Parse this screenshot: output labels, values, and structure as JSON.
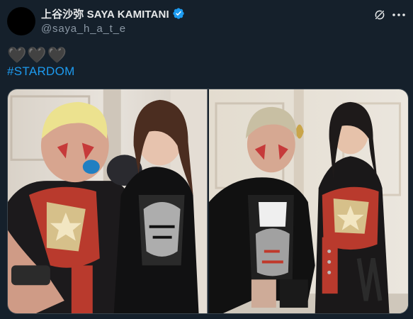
{
  "author": {
    "display_name": "上谷沙弥 SAYA KAMITANI",
    "handle": "@saya_h_a_t_e",
    "verified": true
  },
  "post": {
    "hearts": "🖤🖤🖤",
    "hashtag": "#STARDOM"
  },
  "icons": {
    "grok": "grok-icon",
    "more": "more-options-icon",
    "verified": "verified-badge-icon"
  },
  "colors": {
    "background": "#15202b",
    "link": "#1d9bf0",
    "verified_badge": "#1d9bf0",
    "secondary_text": "#8b98a5"
  }
}
